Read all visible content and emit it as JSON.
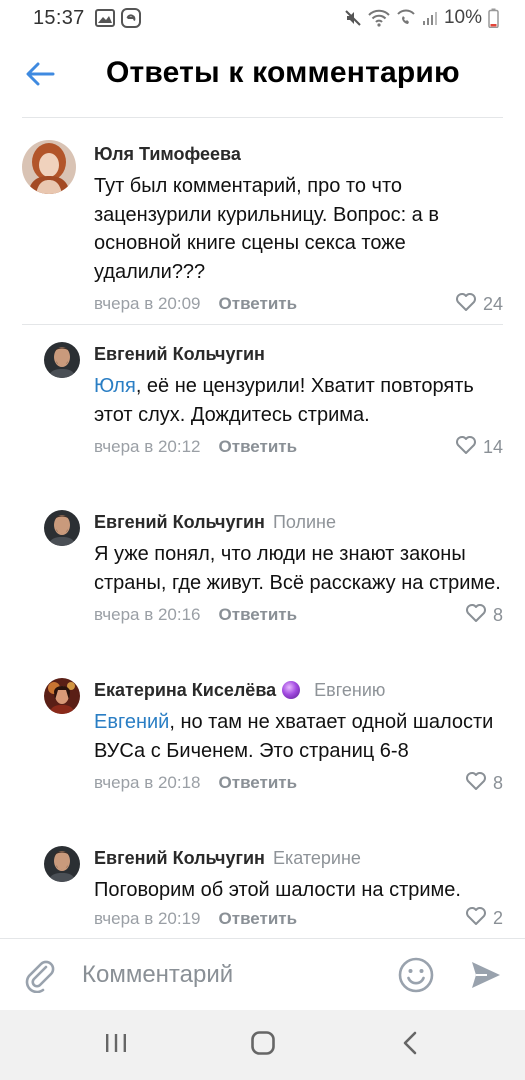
{
  "status_bar": {
    "time": "15:37",
    "battery": "10%"
  },
  "header": {
    "title": "Ответы к комментарию"
  },
  "colors": {
    "accent": "#2a7ec4",
    "meta": "#9a9fa5",
    "divider": "#e4e6e8"
  },
  "comments": [
    {
      "author": "Юля Тимофеева",
      "reply_to": "",
      "mention": "",
      "text": "Тут был комментарий, про то что зацензурили курильницу. Вопрос: а в основной книге сцены секса тоже удалили???",
      "date": "вчера в 20:09",
      "reply_label": "Ответить",
      "likes": "24"
    },
    {
      "author": "Евгений Кольчугин",
      "reply_to": "",
      "mention": "Юля",
      "text": ", её не цензурили! Хватит повторять этот слух. Дождитесь стрима.",
      "date": "вчера в 20:12",
      "reply_label": "Ответить",
      "likes": "14"
    },
    {
      "author": "Евгений Кольчугин",
      "reply_to": "Полине",
      "mention": "",
      "text": "Я уже понял, что люди не знают законы страны, где живут. Всё расскажу на стриме.",
      "date": "вчера в 20:16",
      "reply_label": "Ответить",
      "likes": "8"
    },
    {
      "author": "Екатерина Киселёва",
      "reply_to": "Евгению",
      "mention": "Евгений",
      "text": ", но там не хватает одной шалости ВУСа с Биченем. Это страниц 6-8",
      "date": "вчера в 20:18",
      "reply_label": "Ответить",
      "likes": "8"
    },
    {
      "author": "Евгений Кольчугин",
      "reply_to": "Екатерине",
      "mention": "",
      "text": "Поговорим об этой шалости на стриме.",
      "date": "вчера в 20:19",
      "reply_label": "Ответить",
      "likes": "2"
    }
  ],
  "input": {
    "placeholder": "Комментарий"
  },
  "icons": {
    "back": "arrow-left-icon",
    "attach": "paperclip-icon",
    "emoji": "smile-icon",
    "send": "send-icon",
    "like": "heart-icon"
  }
}
